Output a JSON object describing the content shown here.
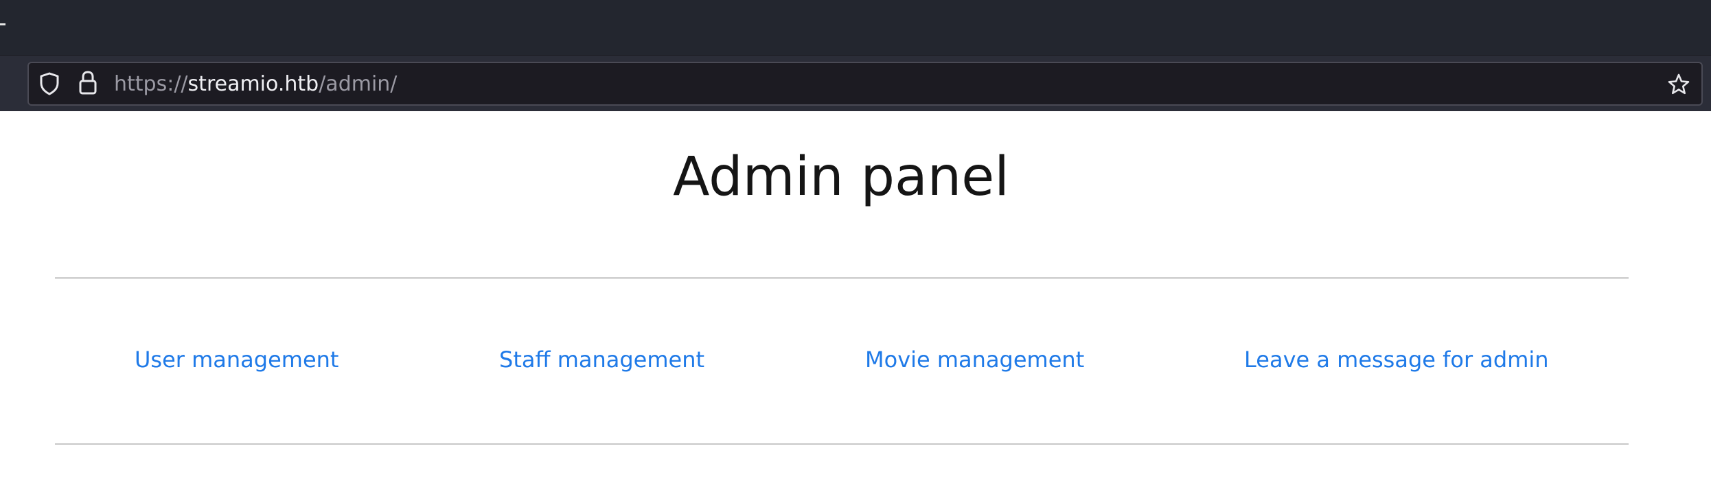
{
  "browser": {
    "url_scheme": "https://",
    "url_host": "streamio.htb",
    "url_path": "/admin/"
  },
  "page": {
    "title": "Admin panel",
    "nav_links": [
      {
        "label": "User management"
      },
      {
        "label": "Staff management"
      },
      {
        "label": "Movie management"
      },
      {
        "label": "Leave a message for admin"
      }
    ]
  },
  "colors": {
    "link": "#1f7ae8",
    "browser_bg": "#23262f",
    "urlbar_bg": "#1c1b22"
  },
  "icons": {
    "tracking_protection": "shield-icon",
    "connection": "lock-icon",
    "bookmark": "star-icon"
  }
}
